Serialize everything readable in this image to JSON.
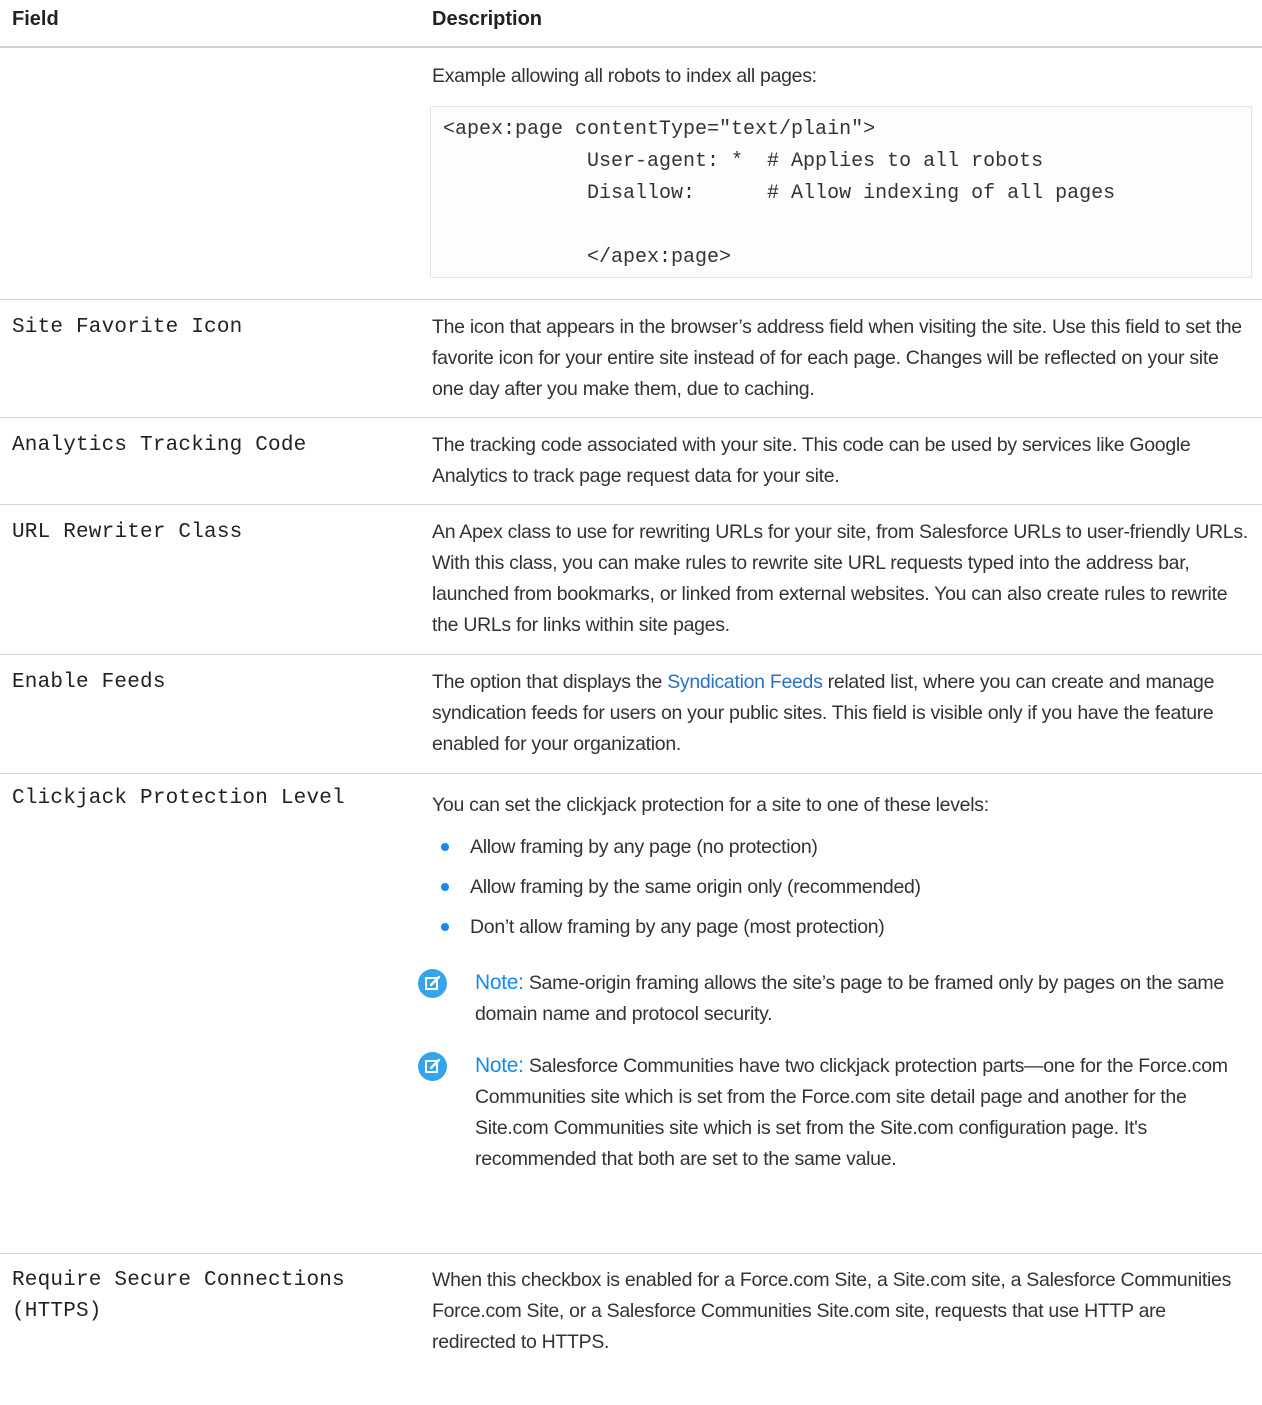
{
  "header": {
    "field": "Field",
    "description": "Description"
  },
  "robots_row": {
    "intro": "Example allowing all robots to index all pages:",
    "code_lines": [
      "<apex:page contentType=\"text/plain\">",
      "            User-agent: *  # Applies to all robots",
      "            Disallow:      # Allow indexing of all pages",
      "",
      "            </apex:page>"
    ]
  },
  "rows": {
    "favicon": {
      "field": "Site Favorite Icon",
      "description": "The icon that appears in the browser’s address field when visiting the site. Use this field to set the favorite icon for your entire site instead of for each page. Changes will be reflected on your site one day after you make them, due to caching."
    },
    "analytics": {
      "field": "Analytics Tracking Code",
      "description": "The tracking code associated with your site. This code can be used by services like Google Analytics to track page request data for your site."
    },
    "rewriter": {
      "field": "URL Rewriter Class",
      "description": "An Apex class to use for rewriting URLs for your site, from Salesforce URLs to user-friendly URLs. With this class, you can make rules to rewrite site URL requests typed into the address bar, launched from bookmarks, or linked from external websites. You can also create rules to rewrite the URLs for links within site pages."
    },
    "feeds": {
      "field": "Enable Feeds",
      "desc_before": "The option that displays the ",
      "desc_link": "Syndication Feeds",
      "desc_after": " related list, where you can create and manage syndication feeds for users on your public sites. This field is visible only if you have the feature enabled for your organization."
    },
    "clickjack": {
      "field": "Clickjack Protection Level",
      "intro": "You can set the clickjack protection for a site to one of these levels:",
      "levels": [
        "Allow framing by any page (no protection)",
        "Allow framing by the same origin only (recommended)",
        "Don’t allow framing by any page (most protection)"
      ],
      "note_label": "Note:",
      "note1": "Same-origin framing allows the site’s page to be framed only by pages on the same domain name and protocol security.",
      "note2": "Salesforce Communities have two clickjack protection parts—one for the Force.com Communities site which is set from the Force.com site detail page and another for the Site.com Communities site which is set from the Site.com configuration page. It's recommended that both are set to the same value."
    },
    "https": {
      "field_line1": "Require Secure Connections",
      "field_line2": "(HTTPS)",
      "description": "When this checkbox is enabled for a Force.com Site, a Site.com site, a Salesforce Communities Force.com Site, or a Salesforce Communities Site.com site, requests that use HTTP are redirected to HTTPS."
    }
  },
  "colors": {
    "accent": "#1589ee",
    "link": "#2a70c8",
    "divider": "#d4d4d4"
  }
}
